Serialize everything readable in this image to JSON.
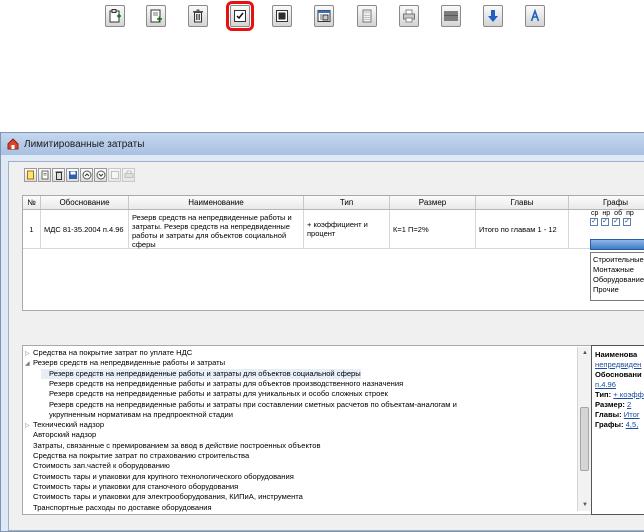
{
  "toolbar_icons": [
    "add-document-icon",
    "add-file-icon",
    "delete-icon",
    "checkbox-edit-icon",
    "list-icon",
    "calculator-window-icon",
    "calculator-icon",
    "print-icon",
    "gray-bar-icon",
    "arrow-down-icon",
    "letter-a-icon"
  ],
  "window": {
    "title": "Лимитированные затраты"
  },
  "table": {
    "columns": [
      "№",
      "Обоснование",
      "Наименование",
      "Тип",
      "Размер",
      "Главы",
      "Графы"
    ],
    "row": {
      "num": "1",
      "basis": "МДС 81-35.2004 п.4.96",
      "name": "Резерв средств на непредвиденные работы и затраты. Резерв средств на непредвиденные работы и затраты для объектов социальной сферы",
      "type": "+ коэффициент и процент",
      "size": "К=1 П=2%",
      "chapters": "Итого по главам 1 - 12"
    },
    "flag_labels": [
      "ср",
      "нр",
      "об",
      "пр"
    ],
    "dropdown_arrow": "▼",
    "dropdown_options": [
      "Строительные",
      "Монтажные",
      "Оборудование",
      "Прочие"
    ]
  },
  "tree": {
    "items": [
      {
        "label": "Средства на покрытие затрат по уплате НДС",
        "twist": "▷"
      },
      {
        "label": "Резерв средств на непредвиденные работы и затраты",
        "twist": "◢"
      },
      {
        "label": "Резерв средств на непредвиденные работы и затраты для объектов социальной сферы",
        "twist": ""
      },
      {
        "label": "Резерв средств на непредвиденные работы и затраты для объектов производственного назначения",
        "twist": ""
      },
      {
        "label": "Резерв средств на непредвиденные работы и затраты для уникальных и особо сложных строек",
        "twist": ""
      },
      {
        "label": "Резерв средств на непредвиденные работы и затраты при составлении сметных расчетов по объектам-аналогам и",
        "twist": ""
      },
      {
        "label": "укрупненным нормативам на предпроектной стадии",
        "twist": ""
      },
      {
        "label": "Технический надзор",
        "twist": "▷"
      },
      {
        "label": "Авторский надзор",
        "twist": ""
      },
      {
        "label": "Затраты, связанные с премированием за ввод в действие построенных объектов",
        "twist": ""
      },
      {
        "label": "Средства на покрытие затрат по страхованию строительства",
        "twist": ""
      },
      {
        "label": "Стоимость зап.частей к оборудованию",
        "twist": ""
      },
      {
        "label": "Стоимость тары и упаковки для крупного технологического оборудования",
        "twist": ""
      },
      {
        "label": "Стоимость тары и упаковки для станочного оборудования",
        "twist": ""
      },
      {
        "label": "Стоимость тары и упаковки для электрооборудования, КИПиА, инструмента",
        "twist": ""
      },
      {
        "label": "Транспортные расходы по доставке оборудования",
        "twist": ""
      }
    ],
    "scroll_up": "▲",
    "scroll_down": "▼"
  },
  "info": {
    "name_label": "Наименова",
    "name_value": "непредвиден",
    "basis_label": "Обосновани",
    "basis_value": "п.4.96",
    "type_label": "Тип:",
    "type_value": "+ коэфф",
    "size_label": "Размер:",
    "size_value": "2",
    "chapters_label": "Главы:",
    "chapters_value": "Итог",
    "columns_label": "Графы:",
    "columns_value": "4,5,"
  }
}
